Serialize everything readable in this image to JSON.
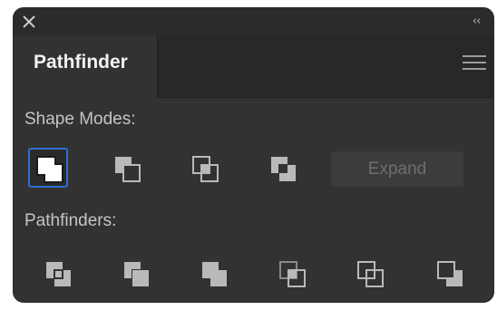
{
  "window": {
    "close_icon": "close-icon",
    "collapse_label": "‹‹"
  },
  "tab": {
    "label": "Pathfinder"
  },
  "panel_menu_icon": "hamburger-menu-icon",
  "shape_modes": {
    "label": "Shape Modes:",
    "buttons": [
      "unite-icon",
      "minus-front-icon",
      "intersect-icon",
      "exclude-icon"
    ],
    "selected": 0,
    "expand_label": "Expand"
  },
  "pathfinders": {
    "label": "Pathfinders:",
    "buttons": [
      "divide-icon",
      "trim-icon",
      "merge-icon",
      "crop-icon",
      "outline-icon",
      "minus-back-icon"
    ]
  },
  "colors": {
    "panel_bg": "#323232",
    "selection_border": "#2f6fd6",
    "icon_fill": "#b9b9b9"
  }
}
